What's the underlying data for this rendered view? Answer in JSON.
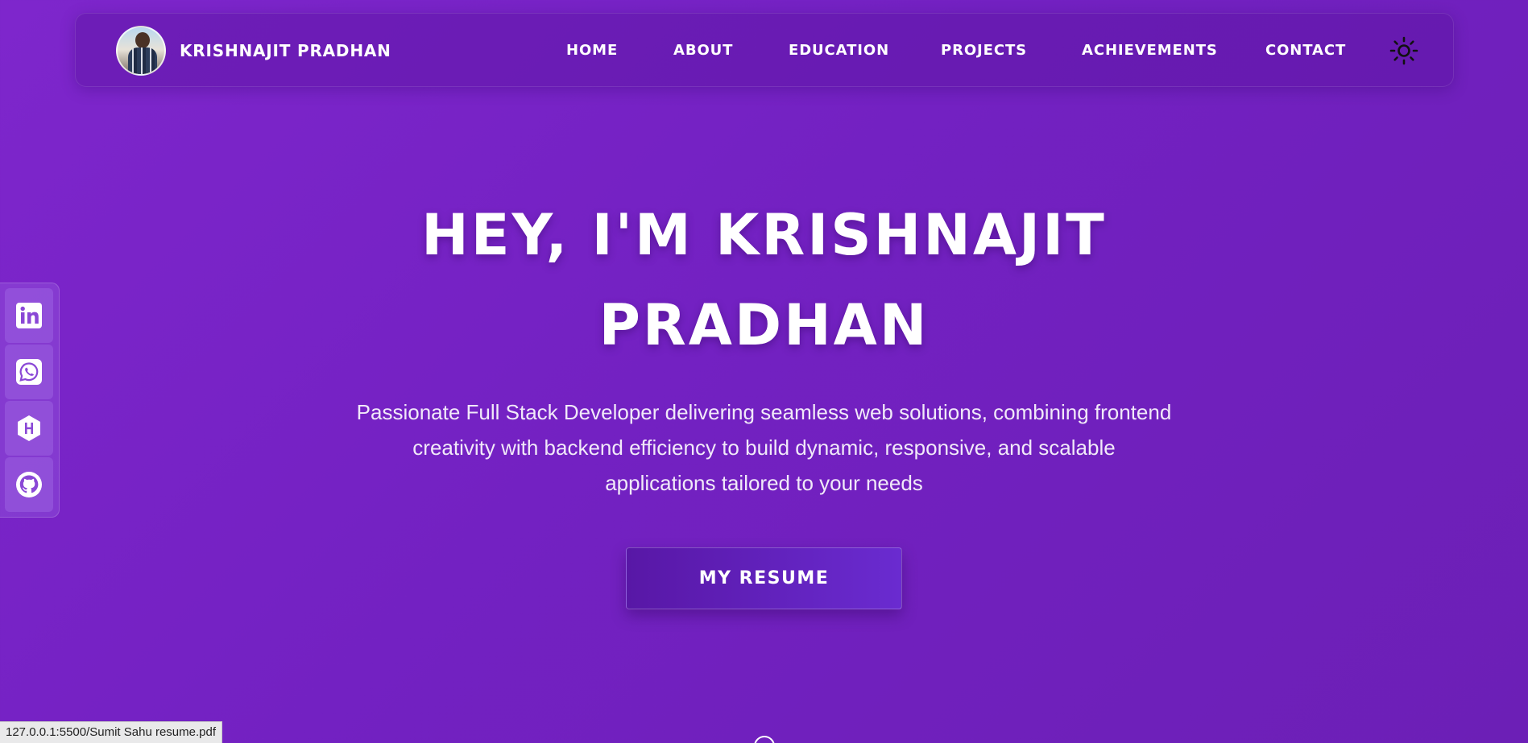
{
  "brand": {
    "name": "KRISHNAJIT PRADHAN"
  },
  "nav": {
    "items": [
      {
        "label": "HOME"
      },
      {
        "label": "ABOUT"
      },
      {
        "label": "EDUCATION"
      },
      {
        "label": "PROJECTS"
      },
      {
        "label": "ACHIEVEMENTS"
      },
      {
        "label": "CONTACT"
      }
    ],
    "theme_icon": "sun-icon"
  },
  "social": {
    "icons": [
      "linkedin-icon",
      "whatsapp-icon",
      "hashnode-icon",
      "github-icon"
    ]
  },
  "hero": {
    "title_line1": "HEY, I'M KRISHNAJIT",
    "title_line2": "PRADHAN",
    "subtitle_line1": "Passionate Full Stack Developer delivering seamless web solutions, combining frontend",
    "subtitle_line2": "creativity with backend efficiency to build dynamic, responsive, and scalable",
    "subtitle_line3": "applications tailored to your needs",
    "cta_label": "MY RESUME"
  },
  "status": {
    "url": "127.0.0.1:5500/Sumit Sahu resume.pdf"
  },
  "colors": {
    "background": "#7321c2",
    "navbar": "#6a1eb8",
    "button": "#5f1eb8"
  }
}
